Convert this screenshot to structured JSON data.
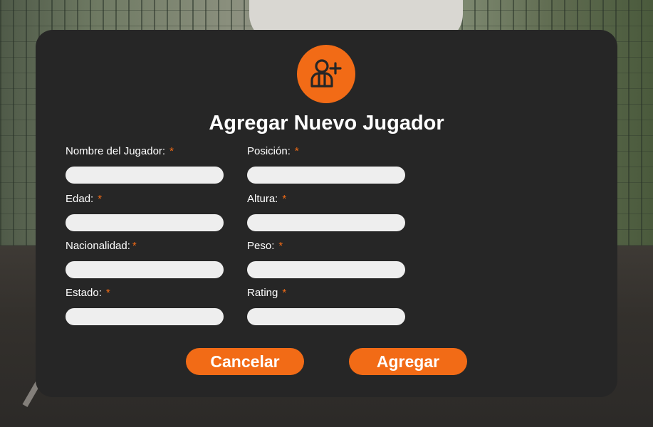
{
  "dialog": {
    "title": "Agregar Nuevo Jugador",
    "icon": "add-user-icon",
    "accent_color": "#f26b16",
    "background_color": "#262626"
  },
  "fields": [
    {
      "label": "Nombre del Jugador:",
      "required_mark": "*",
      "value": "",
      "placeholder": ""
    },
    {
      "label": "Posición:",
      "required_mark": "*",
      "value": "",
      "placeholder": ""
    },
    {
      "label": "Edad:",
      "required_mark": "*",
      "value": "",
      "placeholder": ""
    },
    {
      "label": "Altura:",
      "required_mark": "*",
      "value": "",
      "placeholder": ""
    },
    {
      "label": "Nacionalidad:",
      "required_mark": "*",
      "value": "",
      "placeholder": ""
    },
    {
      "label": "Peso:",
      "required_mark": "*",
      "value": "",
      "placeholder": ""
    },
    {
      "label": "Estado:",
      "required_mark": "*",
      "value": "",
      "placeholder": ""
    },
    {
      "label": "Rating",
      "required_mark": "*",
      "value": "",
      "placeholder": ""
    }
  ],
  "buttons": {
    "cancel_label": "Cancelar",
    "submit_label": "Agregar"
  }
}
